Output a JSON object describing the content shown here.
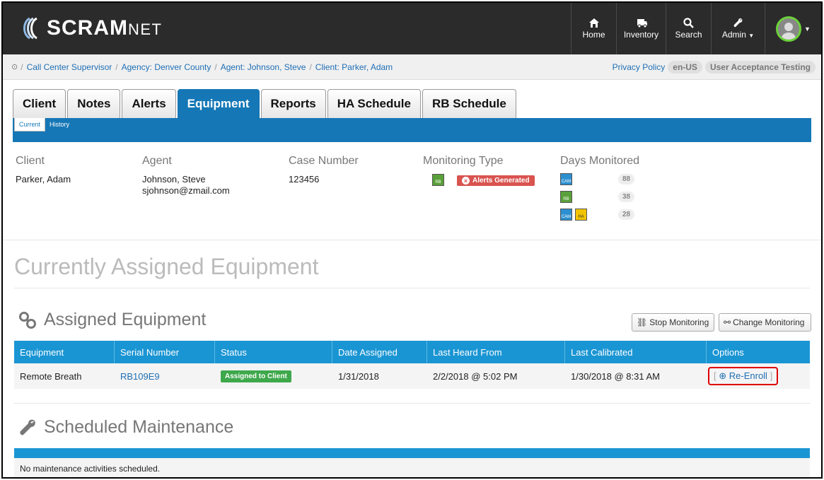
{
  "app": {
    "logo_main": "SCRAM",
    "logo_suffix": "NET"
  },
  "nav": {
    "home": "Home",
    "inventory": "Inventory",
    "search": "Search",
    "admin": "Admin"
  },
  "breadcrumb": {
    "items": [
      "Call Center Supervisor",
      "Agency: Denver County",
      "Agent: Johnson, Steve",
      "Client: Parker, Adam"
    ],
    "privacy": "Privacy Policy",
    "locale": "en-US",
    "environment": "User Acceptance Testing"
  },
  "tabs": [
    "Client",
    "Notes",
    "Alerts",
    "Equipment",
    "Reports",
    "HA Schedule",
    "RB Schedule"
  ],
  "active_tab": "Equipment",
  "subtabs": [
    "Current",
    "History"
  ],
  "info": {
    "client_label": "Client",
    "client_value": "Parker, Adam",
    "agent_label": "Agent",
    "agent_name": "Johnson, Steve",
    "agent_email": "sjohnson@zmail.com",
    "case_label": "Case Number",
    "case_value": "123456",
    "monitoring_label": "Monitoring Type",
    "monitoring_badge": "RB",
    "alerts_tag": "Alerts Generated",
    "days_label": "Days Monitored",
    "days": [
      {
        "badges": [
          "CAM"
        ],
        "count": "88"
      },
      {
        "badges": [
          "RB"
        ],
        "count": "38"
      },
      {
        "badges": [
          "CAM",
          "HA"
        ],
        "count": "28"
      }
    ]
  },
  "section_title": "Currently Assigned Equipment",
  "assigned": {
    "title": "Assigned Equipment",
    "stop_button": "Stop Monitoring",
    "change_button": "Change Monitoring",
    "columns": [
      "Equipment",
      "Serial Number",
      "Status",
      "Date Assigned",
      "Last Heard From",
      "Last Calibrated",
      "Options"
    ],
    "row": {
      "equipment": "Remote Breath",
      "serial": "RB109E9",
      "status": "Assigned to Client",
      "date_assigned": "1/31/2018",
      "last_heard": "2/2/2018 @ 5:02 PM",
      "last_calibrated": "1/30/2018 @ 8:31 AM",
      "option": "Re-Enroll"
    }
  },
  "maintenance": {
    "title": "Scheduled Maintenance",
    "empty": "No maintenance activities scheduled."
  },
  "colors": {
    "navbar": "#2b2b2b",
    "tab_blue": "#1677b6",
    "table_blue": "#1a95d3",
    "alert_red": "#d9534f",
    "status_green": "#3ea84b",
    "highlight": "#e00000"
  }
}
